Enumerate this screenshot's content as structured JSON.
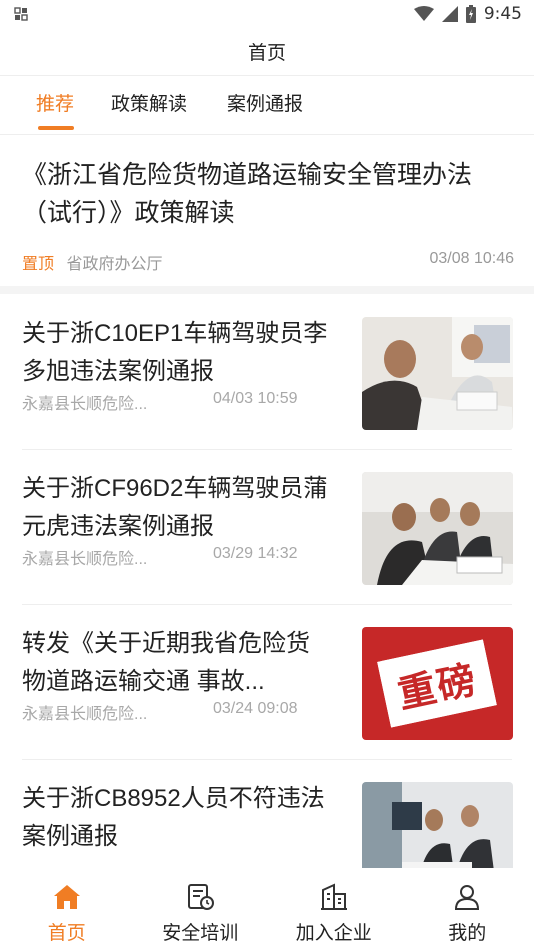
{
  "status_bar": {
    "time": "9:45"
  },
  "header": {
    "title": "首页"
  },
  "tabs": [
    {
      "label": "推荐",
      "active": true
    },
    {
      "label": "政策解读",
      "active": false
    },
    {
      "label": "案例通报",
      "active": false
    }
  ],
  "featured": {
    "title": "《浙江省危险货物道路运输安全管理办法（试行）》政策解读",
    "badge": "置顶",
    "source": "省政府办公厅",
    "time": "03/08 10:46"
  },
  "list": [
    {
      "title": "关于浙C10EP1车辆驾驶员李多旭违法案例通报",
      "source": "永嘉县长顺危险...",
      "time": "04/03 10:59",
      "thumb": "photo-office-meeting"
    },
    {
      "title": "关于浙CF96D2车辆驾驶员蒲元虎违法案例通报",
      "source": "永嘉县长顺危险...",
      "time": "03/29 14:32",
      "thumb": "photo-group-signing"
    },
    {
      "title": "转发《关于近期我省危险货物道路运输交通 事故...",
      "source": "永嘉县长顺危险...",
      "time": "03/24 09:08",
      "thumb": "red-stamp-banner",
      "thumb_text": "重磅"
    },
    {
      "title": "关于浙CB8952人员不符违法案例通报",
      "source": "",
      "time": "",
      "thumb": "photo-office-desk"
    }
  ],
  "bottom_nav": [
    {
      "label": "首页",
      "icon": "home-icon",
      "active": true
    },
    {
      "label": "安全培训",
      "icon": "training-icon",
      "active": false
    },
    {
      "label": "加入企业",
      "icon": "building-icon",
      "active": false
    },
    {
      "label": "我的",
      "icon": "person-icon",
      "active": false
    }
  ],
  "colors": {
    "accent": "#f07d24",
    "text": "#222222",
    "muted": "#999999"
  }
}
